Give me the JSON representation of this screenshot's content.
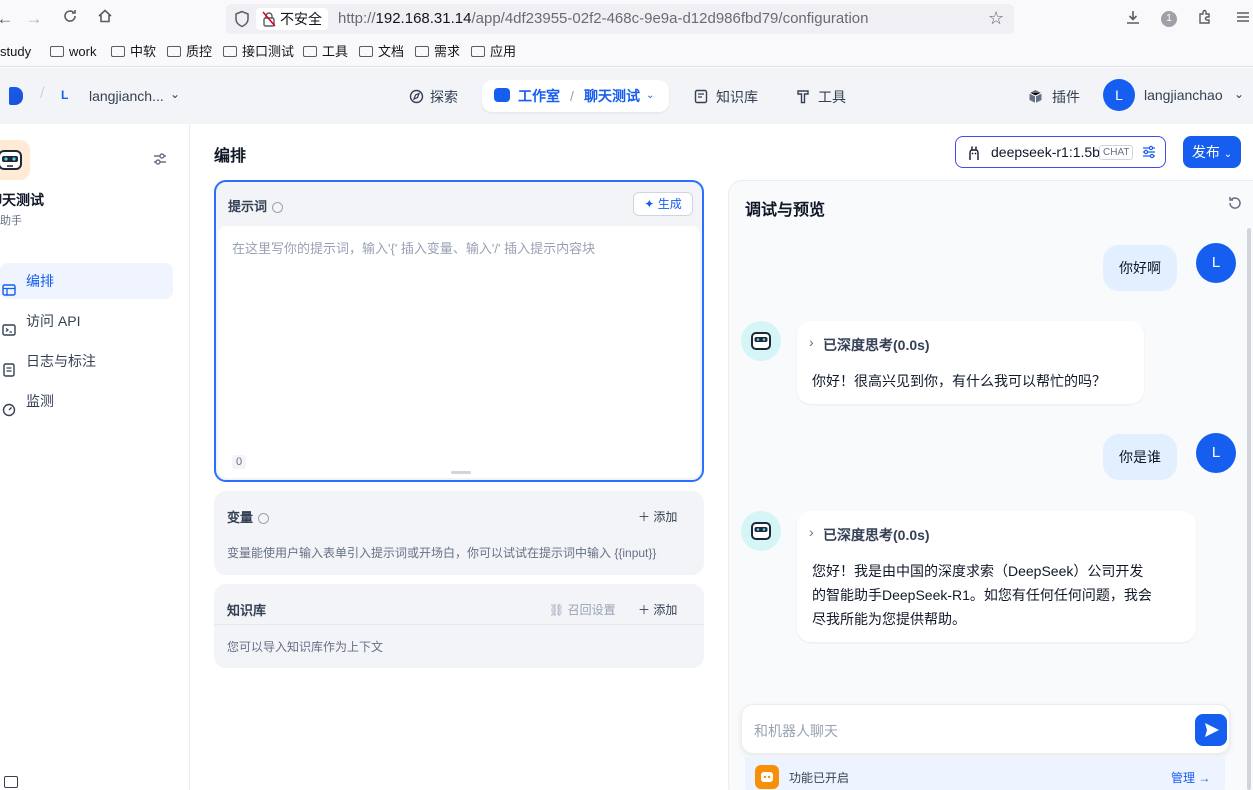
{
  "browser": {
    "nav_back": "←",
    "nav_forward": "→",
    "insecure_label": "不安全",
    "url_prefix": "http://",
    "url_host": "192.168.31.14",
    "url_path": "/app/4df23955-02f2-468c-9e9a-d12d986fbd79/configuration",
    "account_badge": "1"
  },
  "bookmarks": [
    "study",
    "work",
    "中软",
    "质控",
    "接口测试",
    "工具",
    "文档",
    "需求",
    "应用"
  ],
  "header": {
    "workspace_avatar": "L",
    "workspace_name": "langjianch...",
    "nav": {
      "explore": "探索",
      "studio": "工作室",
      "app_name": "聊天测试",
      "knowledge": "知识库",
      "tools": "工具"
    },
    "plugins": "插件",
    "user_avatar": "L",
    "user_name": "langjianchao"
  },
  "sidebar": {
    "app_title": "聊天测试",
    "app_type": "聊天助手",
    "items": [
      {
        "label": "编排",
        "active": true
      },
      {
        "label": "访问 API",
        "active": false
      },
      {
        "label": "日志与标注",
        "active": false
      },
      {
        "label": "监测",
        "active": false
      }
    ]
  },
  "orchestration": {
    "title": "编排",
    "prompt": {
      "label": "提示词",
      "generate": "生成",
      "placeholder": "在这里写你的提示词，输入'{' 插入变量、输入'/' 插入提示内容块",
      "count": "0"
    },
    "variables": {
      "title": "变量",
      "add": "添加",
      "desc": "变量能使用户输入表单引入提示词或开场白，你可以试试在提示词中输入 {{input}}"
    },
    "knowledge": {
      "title": "知识库",
      "recall": "召回设置",
      "add": "添加",
      "desc": "您可以导入知识库作为上下文"
    }
  },
  "model": {
    "name": "deepseek-r1:1.5b",
    "badge": "CHAT",
    "publish": "发布"
  },
  "debug": {
    "title": "调试与预览",
    "messages": [
      {
        "role": "user",
        "avatar": "L",
        "text": "你好啊"
      },
      {
        "role": "bot",
        "think": "已深度思考(0.0s)",
        "text": "你好！很高兴见到你，有什么我可以帮忙的吗？"
      },
      {
        "role": "user",
        "avatar": "L",
        "text": "你是谁"
      },
      {
        "role": "bot",
        "think": "已深度思考(0.0s)",
        "lines": [
          "您好！我是由中国的深度求索（DeepSeek）公司开发",
          "的智能助手DeepSeek-R1。如您有任何任何问题，我会",
          "尽我所能为您提供帮助。"
        ]
      }
    ],
    "input_placeholder": "和机器人聊天",
    "feature_text": "功能已开启",
    "manage": "管理"
  },
  "colors": {
    "accent": "#155eef",
    "active_bg": "#eff4ff",
    "user_bubble": "#e1effe"
  }
}
